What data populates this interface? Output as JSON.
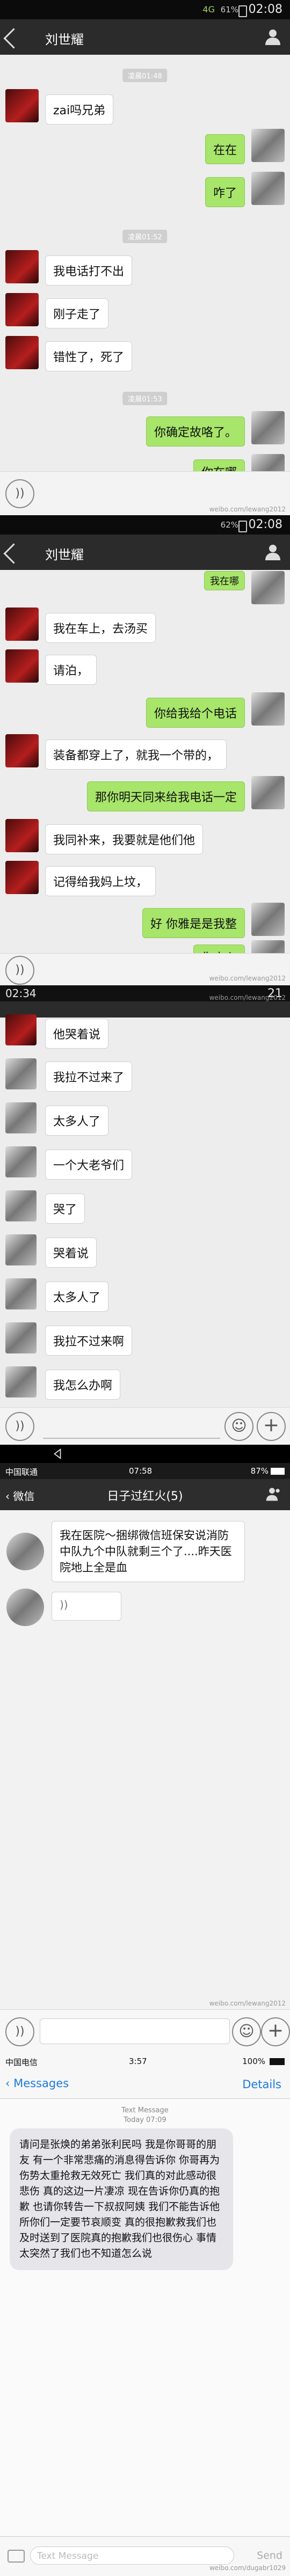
{
  "p1": {
    "status": {
      "signal": "4G",
      "battery": "61%",
      "time": "02:08"
    },
    "title": "刘世耀",
    "timestamps": [
      "凌晨01:48",
      "凌晨01:52",
      "凌晨01:53"
    ],
    "messages": [
      "zai吗兄弟",
      "在在",
      "咋了",
      "我电话打不出",
      "刚子走了",
      "错性了，死了",
      "你确定故咯了。",
      "你在哪"
    ],
    "watermark": "weibo.com/lewang2012"
  },
  "p2": {
    "status": {
      "battery": "62%",
      "time": "02:08"
    },
    "title": "刘世耀",
    "messages": [
      "我在哪",
      "我在车上，去汤买",
      "请泊，",
      "你给我给个电话",
      "装备都穿上了，就我一个带的，",
      "那你明天同来给我电话一定",
      "我同补来，我要就是他们他",
      "记得给我妈上坟，",
      "好 你雅是是我整",
      "你小心"
    ],
    "watermark": "weibo.com/lewang2012"
  },
  "p3": {
    "status": {
      "time": "02:34",
      "right": "21"
    },
    "messages": [
      "他哭着说",
      "我拉不过来了",
      "太多人了",
      "一个大老爷们",
      "哭了",
      "哭着说",
      "太多人了",
      "我拉不过来啊",
      "我怎么办啊"
    ],
    "watermark": "weibo.com/lewang2012"
  },
  "p4": {
    "status": {
      "carrier": "中国联通",
      "time": "07:58",
      "battery": "87%"
    },
    "back_label": "微信",
    "title": "日子过红火(5)",
    "message": "我在医院～捆绑微信班保安说消防中队九个中队就剩三个了....昨天医院地上全是血",
    "voice_icon": "wave-icon",
    "watermark": "weibo.com/lewang2012"
  },
  "p5": {
    "status": {
      "carrier": "中国电信",
      "time": "3:57",
      "battery": "100%"
    },
    "back_label": "Messages",
    "details_label": "Details",
    "meta_line1": "Text Message",
    "meta_line2": "Today 07:09",
    "message": "请问是张焕的弟弟张利民吗 我是你哥哥的朋友 有一个非常悲痛的消息得告诉你 你哥再为伤势太重抢救无效死亡 我们真的对此感动很悲伤 真的这边一片凄凉 现在告诉你仍真的抱歉 也请你转告一下叔叔阿姨 我们不能告诉他所你们一定要节哀顺变 真的很抱歉救我们也及时送到了医院真的抱歉我们也很伤心 事情太突然了我们也不知道怎么说",
    "input_placeholder": "Text Message",
    "send_label": "Send",
    "watermark": "weibo.com/dugabr1029"
  }
}
